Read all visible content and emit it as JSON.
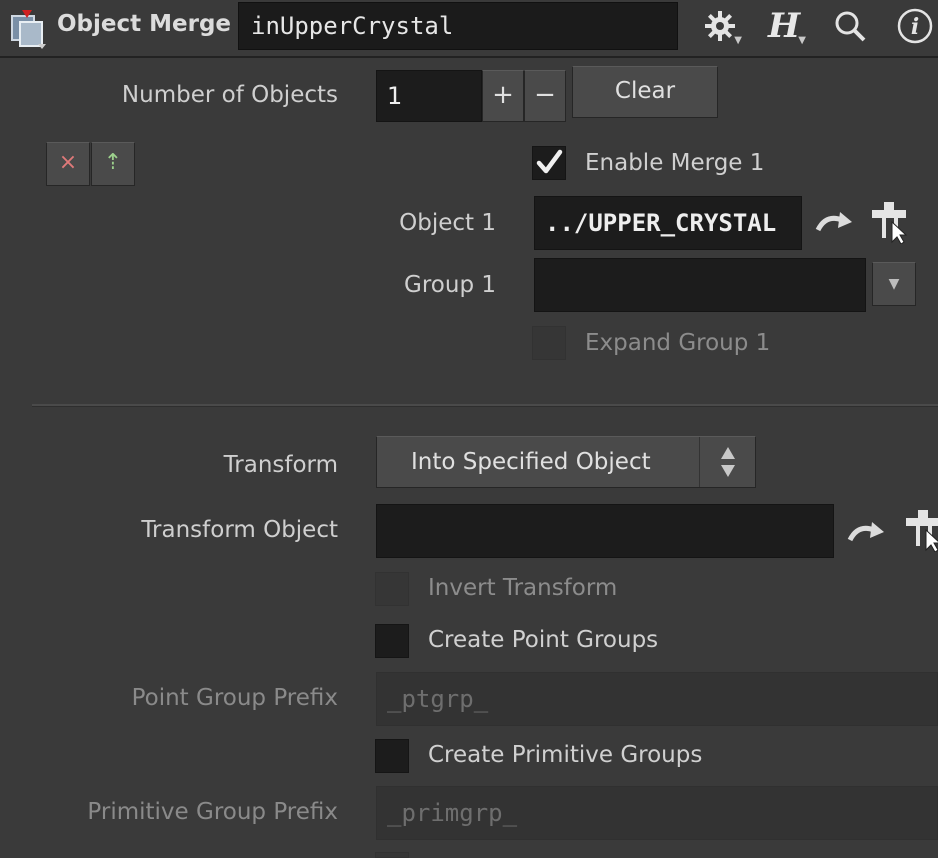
{
  "header": {
    "node_type": "Object Merge",
    "node_name": "inUpperCrystal",
    "icons": [
      "gear-icon",
      "houdini-help-icon",
      "search-icon",
      "info-icon"
    ]
  },
  "num_objects": {
    "label": "Number of Objects",
    "value": "1",
    "plus": "+",
    "minus": "−",
    "clear_label": "Clear"
  },
  "multiparm_buttons": {
    "remove": "×",
    "insert": "⇡"
  },
  "merge1": {
    "enable_label": "Enable Merge 1",
    "enable_checked": true,
    "object_label": "Object 1",
    "object_value": "../UPPER_CRYSTAL",
    "group_label": "Group 1",
    "group_value": "",
    "expand_label": "Expand Group 1"
  },
  "transform": {
    "label": "Transform",
    "value": "Into Specified Object",
    "object_label": "Transform Object",
    "object_value": "",
    "invert_label": "Invert Transform"
  },
  "point_groups": {
    "create_label": "Create Point Groups",
    "prefix_label": "Point Group Prefix",
    "prefix_value": "_ptgrp_"
  },
  "prim_groups": {
    "create_label": "Create Primitive Groups",
    "prefix_label": "Primitive Group Prefix",
    "prefix_value": "_primgrp_"
  }
}
